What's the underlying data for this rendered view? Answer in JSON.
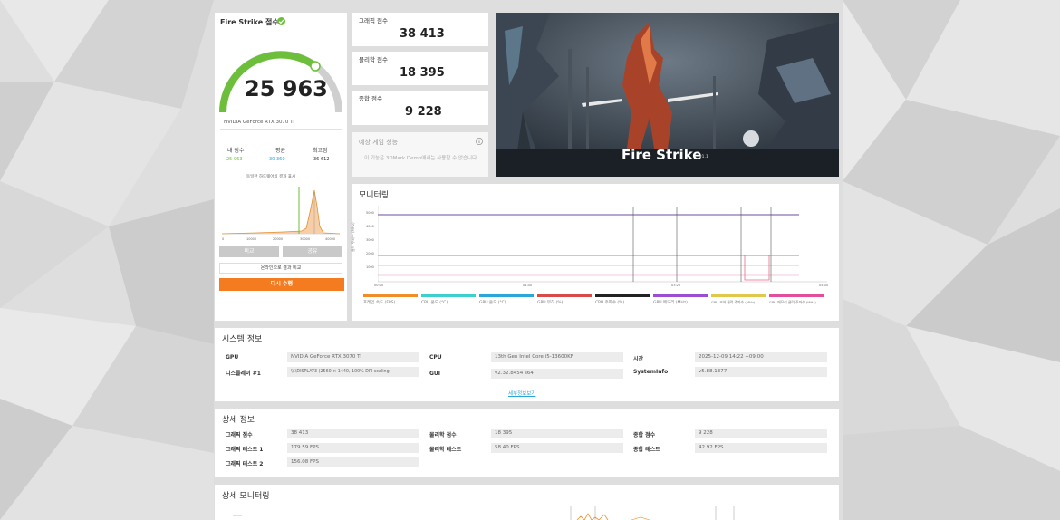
{
  "score_card": {
    "title": "Fire Strike 점수",
    "score": "25 963",
    "gpu_name": "NVIDIA GeForce RTX 3070 Ti",
    "stats_labels": [
      "내 점수",
      "평균",
      "최고점"
    ],
    "stats_values": [
      "25 963",
      "30 360",
      "36 612"
    ],
    "dist_title": "동일한 하드웨어의 결과 표시",
    "btn_left": "비교",
    "btn_right": "공유",
    "btn_compare": "온라인으로 결과 비교",
    "btn_run": "다시 수행",
    "dist_x_ticks": [
      "0",
      "10000",
      "20000",
      "30000",
      "40000"
    ]
  },
  "sub_scores": [
    {
      "label": "그래픽 점수",
      "value": "38 413"
    },
    {
      "label": "물리학 점수",
      "value": "18 395"
    },
    {
      "label": "종합 점수",
      "value": "9 228"
    }
  ],
  "game_perf": {
    "title": "예상 게임 성능",
    "info_icon": "info-icon",
    "text": "이 기능은 3DMark Demo에서는 사용할 수 없습니다."
  },
  "hero": {
    "title": "Fire Strike",
    "version": "v1.1"
  },
  "monitoring": {
    "title": "모니터링",
    "y_axis_label": "클럭 주파수 (MHz)",
    "y_ticks": [
      "5000",
      "4000",
      "3000",
      "2000",
      "1000"
    ],
    "x_ticks": [
      "00:00",
      "01:40",
      "03:20",
      "05:00"
    ],
    "legend": [
      {
        "name": "프레임 속도 (FPS)",
        "color": "#f28c28"
      },
      {
        "name": "CPU 온도 (°C)",
        "color": "#3ecfcf"
      },
      {
        "name": "GPU 온도 (°C)",
        "color": "#2aa6d8"
      },
      {
        "name": "GPU 부하 (%)",
        "color": "#d94a4a"
      },
      {
        "name": "CPU 주파수 (%)",
        "color": "#222222"
      },
      {
        "name": "GPU 메모리 (MHz)",
        "color": "#9b4fd0"
      },
      {
        "name": "GPU 코어 클럭 주파수 (MHz)",
        "color": "#e0c84a"
      },
      {
        "name": "GPU 메모리 클럭 주파수 (MHz)",
        "color": "#e24d9c"
      }
    ],
    "series_colors": {
      "purple": "#8a6fb0",
      "pink": "#e86a8a",
      "orange": "#f0b05a",
      "magenta": "#e06aa6"
    }
  },
  "system_info": {
    "title": "시스템 정보",
    "rows": [
      [
        {
          "label": "GPU",
          "value": "NVIDIA GeForce RTX 3070 Ti"
        },
        {
          "label": "CPU",
          "value": "13th Gen Intel Core i5-13600KF"
        },
        {
          "label": "시간",
          "value": "2025-12-09 14:22 +09:00"
        }
      ],
      [
        {
          "label": "디스플레이 #1",
          "value": "\\\\.\\DISPLAY3 (2560 × 1440, 100% DPI scaling)"
        },
        {
          "label": "GUI",
          "value": "v2.32.8454 s64"
        },
        {
          "label": "SystemInfo",
          "value": "v5.88.1377"
        }
      ]
    ],
    "link": "세부정보보기"
  },
  "detail_info": {
    "title": "상세 정보",
    "rows": [
      [
        {
          "label": "그래픽 점수",
          "value": "38 413"
        },
        {
          "label": "물리학 점수",
          "value": "18 395"
        },
        {
          "label": "종합 점수",
          "value": "9 228"
        }
      ],
      [
        {
          "label": "그래픽 테스트 1",
          "value": "179.59 FPS"
        },
        {
          "label": "물리학 테스트",
          "value": "58.40 FPS"
        },
        {
          "label": "종합 테스트",
          "value": "42.92 FPS"
        }
      ],
      [
        {
          "label": "그래픽 테스트 2",
          "value": "156.08 FPS"
        }
      ]
    ]
  },
  "detail_monitoring": {
    "title": "상세 모니터링"
  },
  "colors": {
    "accent_orange": "#f47b20",
    "gauge_green": "#6dbf3b",
    "gray_button": "#c9c9c9"
  }
}
